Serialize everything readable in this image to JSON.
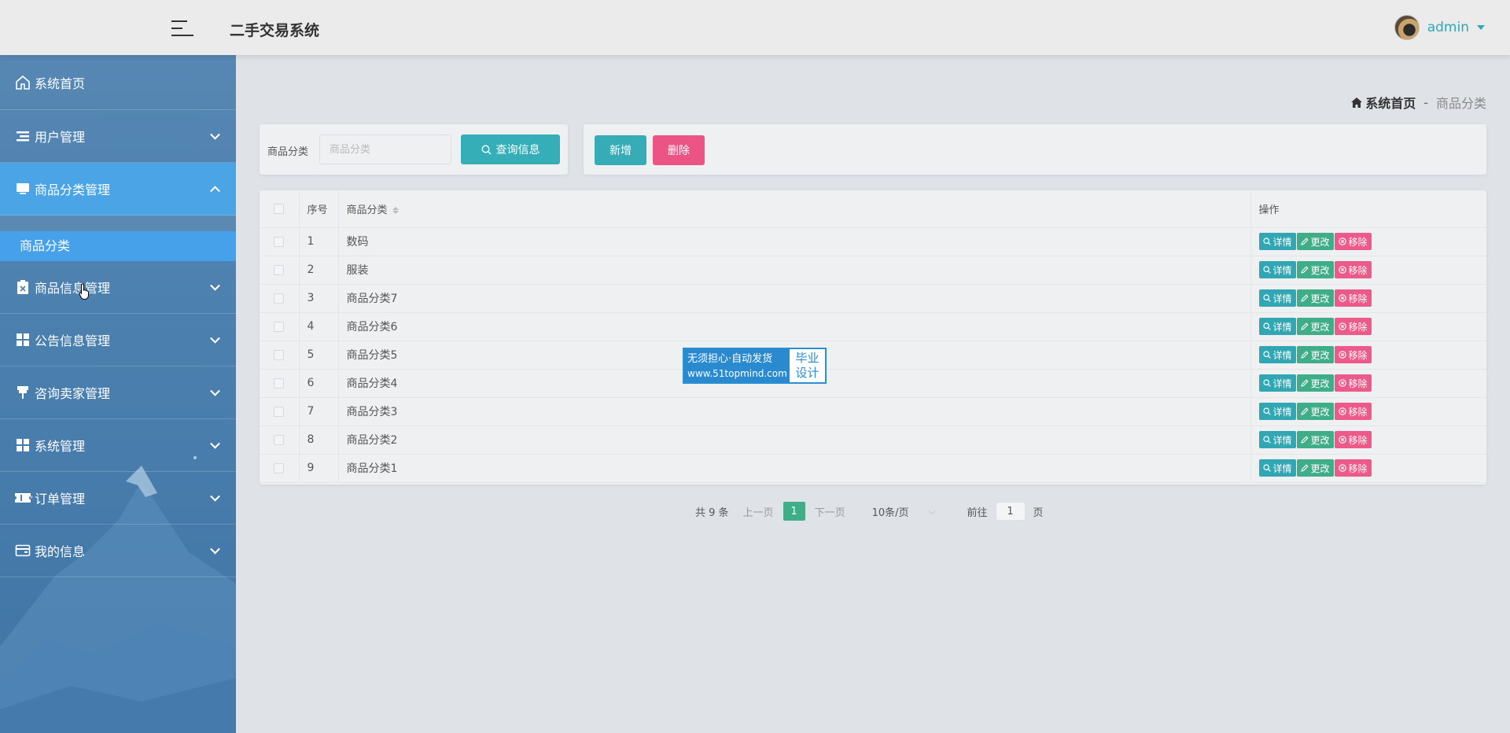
{
  "header": {
    "title": "二手交易系统",
    "user": "admin"
  },
  "sidebar": {
    "items": [
      {
        "label": "系统首页",
        "icon": "home-icon"
      },
      {
        "label": "用户管理",
        "icon": "list-icon"
      },
      {
        "label": "商品分类管理",
        "icon": "monitor-icon"
      },
      {
        "label": "商品信息管理",
        "icon": "clipboard-icon"
      },
      {
        "label": "公告信息管理",
        "icon": "grid-icon"
      },
      {
        "label": "咨询卖家管理",
        "icon": "pin-icon"
      },
      {
        "label": "系统管理",
        "icon": "grid-icon"
      },
      {
        "label": "订单管理",
        "icon": "ticket-icon"
      },
      {
        "label": "我的信息",
        "icon": "card-icon"
      }
    ],
    "submenu": [
      "商品分类"
    ]
  },
  "breadcrumb": {
    "home": "系统首页",
    "separator": "-",
    "current": "商品分类"
  },
  "search": {
    "label": "商品分类",
    "placeholder": "商品分类",
    "button": "查询信息"
  },
  "actions": {
    "add": "新增",
    "delete": "删除"
  },
  "table": {
    "headers": {
      "no": "序号",
      "name": "商品分类",
      "ops": "操作"
    },
    "op_labels": {
      "detail": "详情",
      "edit": "更改",
      "remove": "移除"
    },
    "rows": [
      {
        "no": "1",
        "name": "数码"
      },
      {
        "no": "2",
        "name": "服装"
      },
      {
        "no": "3",
        "name": "商品分类7"
      },
      {
        "no": "4",
        "name": "商品分类6"
      },
      {
        "no": "5",
        "name": "商品分类5"
      },
      {
        "no": "6",
        "name": "商品分类4"
      },
      {
        "no": "7",
        "name": "商品分类3"
      },
      {
        "no": "8",
        "name": "商品分类2"
      },
      {
        "no": "9",
        "name": "商品分类1"
      }
    ]
  },
  "watermark": {
    "line1": "无须担心·自动发货",
    "line2": "www.51topmind.com",
    "right1": "毕业",
    "right2": "设计"
  },
  "pagination": {
    "total": "共 9 条",
    "prev": "上一页",
    "current_page": "1",
    "next": "下一页",
    "page_size": "10条/页",
    "goto_label": "前往",
    "goto_value": "1",
    "goto_suffix": "页"
  },
  "colors": {
    "accent_teal": "#35aeb8",
    "accent_green": "#3fae88",
    "accent_pink": "#ec5485",
    "sidebar_active": "#4aa4e6"
  }
}
